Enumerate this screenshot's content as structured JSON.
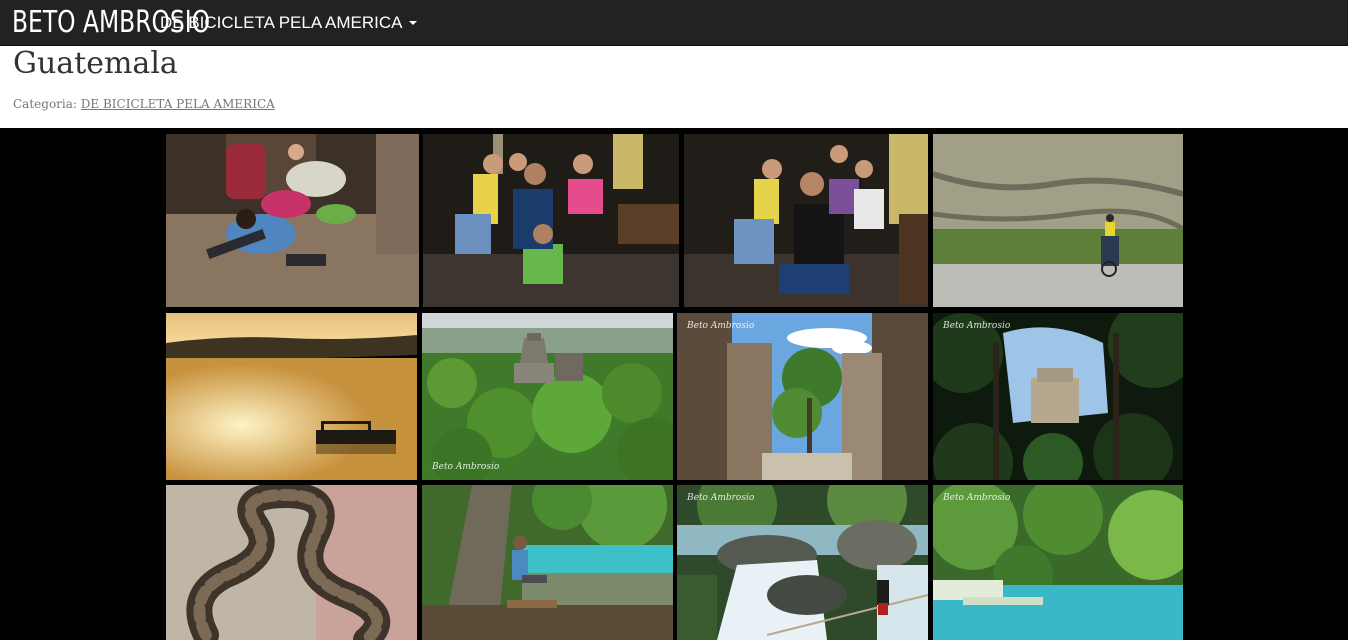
{
  "navbar": {
    "brand": "BETO AMBROSIO",
    "menu_label": "DE BICICLETA PELA AMERICA"
  },
  "post": {
    "title": "Guatemala",
    "category_prefix": "Categoria:",
    "category_link": "DE BICICLETA PELA AMERICA"
  },
  "gallery": {
    "signature": "Beto Ambrosio",
    "photos": [
      {
        "name": "photo-family-floor-play"
      },
      {
        "name": "photo-group-kids-night"
      },
      {
        "name": "photo-group-kids-night-2"
      },
      {
        "name": "photo-cyclist-road-rockface"
      },
      {
        "name": "photo-sunset-lake-boat"
      },
      {
        "name": "photo-tikal-temple-jungle"
      },
      {
        "name": "photo-ruins-walls-tree"
      },
      {
        "name": "photo-temple-through-jungle"
      },
      {
        "name": "photo-boa-snake"
      },
      {
        "name": "photo-man-sitting-turquoise-pool"
      },
      {
        "name": "photo-waterfall-rapids"
      },
      {
        "name": "photo-turquoise-pools-jungle"
      }
    ]
  }
}
